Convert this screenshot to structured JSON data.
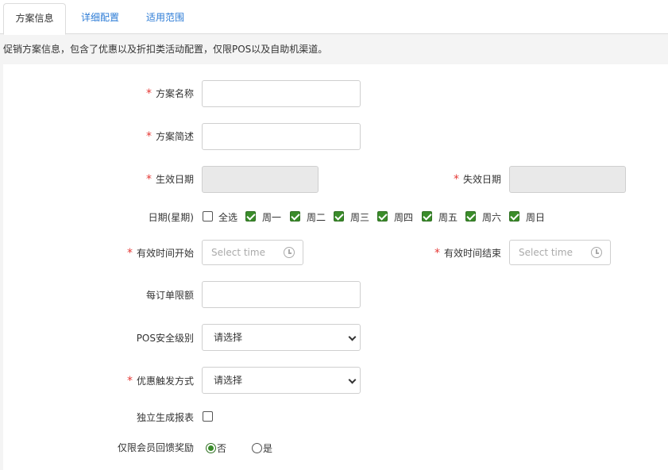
{
  "tabs": [
    {
      "label": "方案信息"
    },
    {
      "label": "详细配置"
    },
    {
      "label": "适用范围"
    }
  ],
  "notice": "促销方案信息，包含了优惠以及折扣类活动配置，仅限POS以及自助机渠道。",
  "required_mark": "*",
  "form": {
    "plan_name_label": "方案名称",
    "plan_desc_label": "方案简述",
    "start_date_label": "生效日期",
    "end_date_label": "失效日期",
    "weekday_label": "日期(星期)",
    "select_all_label": "全选",
    "weekdays": [
      "周一",
      "周二",
      "周三",
      "周四",
      "周五",
      "周六",
      "周日"
    ],
    "time_start_label": "有效时间开始",
    "time_end_label": "有效时间结束",
    "time_placeholder": "Select time",
    "order_limit_label": "每订单限额",
    "pos_level_label": "POS安全级别",
    "pos_level_value": "请选择",
    "trigger_label": "优惠触发方式",
    "trigger_value": "请选择",
    "report_label": "独立生成报表",
    "member_label": "仅限会员回馈奖励",
    "member_no": "否",
    "member_yes": "是"
  }
}
